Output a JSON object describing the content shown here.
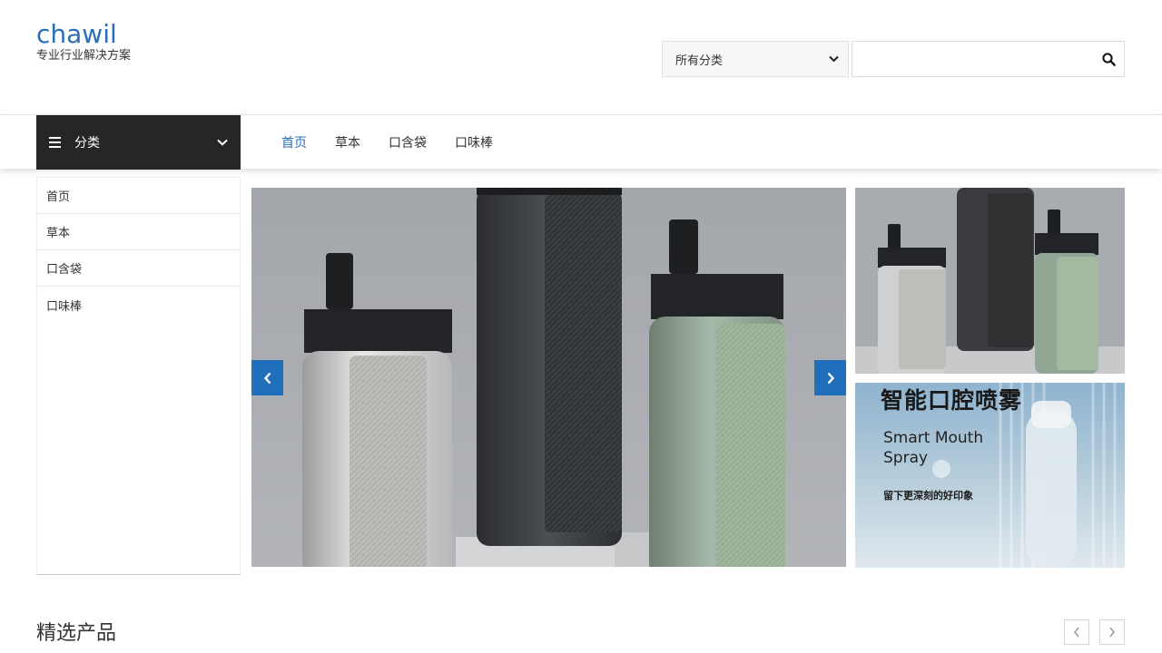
{
  "brand": {
    "name": "chawil",
    "tagline": "专业行业解决方案"
  },
  "search": {
    "category_selected": "所有分类",
    "input_value": "",
    "placeholder": ""
  },
  "nav": {
    "categories_toggle_label": "分类",
    "links": [
      {
        "label": "首页",
        "active": true
      },
      {
        "label": "草本",
        "active": false
      },
      {
        "label": "口含袋",
        "active": false
      },
      {
        "label": "口味棒",
        "active": false
      }
    ]
  },
  "sidebar": {
    "items": [
      {
        "label": "首页"
      },
      {
        "label": "草本"
      },
      {
        "label": "口含袋"
      },
      {
        "label": "口味棒"
      }
    ]
  },
  "banner_side": {
    "title_cn": "智能口腔喷雾",
    "title_en": "Smart Mouth Spray",
    "tagline": "留下更深刻的好印象"
  },
  "featured": {
    "title": "精选产品"
  },
  "colors": {
    "brand": "#2a6fb5",
    "category_bar": "#262626",
    "slider_arrow": "#1f6fbd"
  }
}
